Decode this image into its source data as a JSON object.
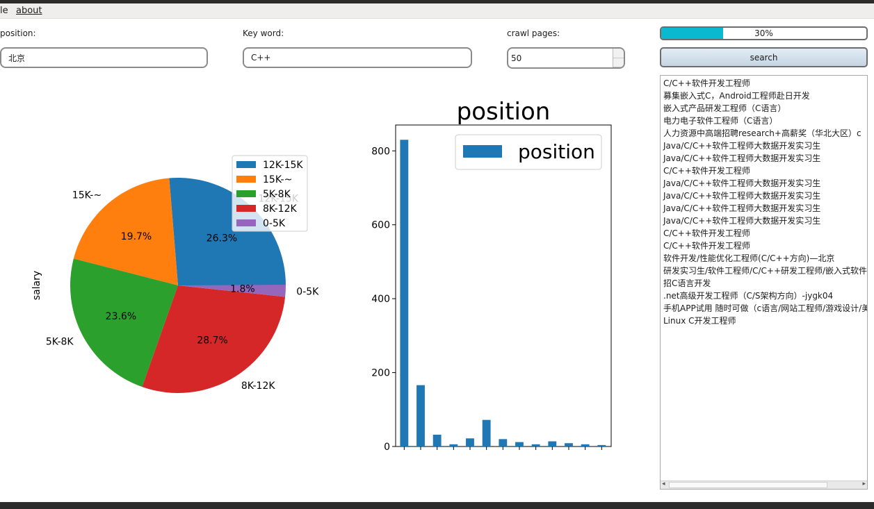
{
  "menu": {
    "file": "le",
    "about": "about"
  },
  "form": {
    "position_label": "position:",
    "position_value": "北京",
    "keyword_label": "Key word:",
    "keyword_value": "C++",
    "pages_label": "crawl pages:",
    "pages_value": "50"
  },
  "progress": {
    "text": "30%",
    "value": 0.3
  },
  "search_button": "search",
  "results": [
    "C/C++软件开发工程师",
    "募集嵌入式C，Android工程师赴日开发",
    "嵌入式产品研发工程师（C语言）",
    "电力电子软件工程师（C语言）",
    "人力资源中高端招聘research+高薪奖（华北大区）c",
    "Java/C/C++软件工程师大数据开发实习生",
    "Java/C/C++软件工程师大数据开发实习生",
    "C/C++软件开发工程师",
    "Java/C/C++软件工程师大数据开发实习生",
    "Java/C/C++软件工程师大数据开发实习生",
    "Java/C/C++软件工程师大数据开发实习生",
    "Java/C/C++软件工程师大数据开发实习生",
    "C/C++软件开发工程师",
    "C/C++软件开发工程师",
    "软件开发/性能优化工程师(C/C++方向)—北京",
    "研发实习生/软件工程师/C/C++研发工程师/嵌入式软件开",
    "招C语言开发",
    ".net高级开发工程师（C/S架构方向）-jygk04",
    "手机APP试用 随时可做（c语言/网站工程师/游戏设计/美",
    "Linux C开发工程师"
  ],
  "chart_data": [
    {
      "type": "pie",
      "ylabel": "salary",
      "slices": [
        {
          "label": "12K-15K",
          "percent": 26.3,
          "pct_label": "26.3%",
          "color": "#1f77b4"
        },
        {
          "label": "15K-~",
          "percent": 19.7,
          "pct_label": "19.7%",
          "color": "#ff7f0e"
        },
        {
          "label": "5K-8K",
          "percent": 23.6,
          "pct_label": "23.6%",
          "color": "#2ca02c"
        },
        {
          "label": "8K-12K",
          "percent": 28.7,
          "pct_label": "28.7%",
          "color": "#d62728"
        },
        {
          "label": "0-5K",
          "percent": 1.8,
          "pct_label": "1.8%",
          "color": "#9467bd"
        }
      ],
      "legend": [
        "12K-15K",
        "15K-~",
        "5K-8K",
        "8K-12K",
        "0-5K"
      ],
      "legend_position": "upper-right"
    },
    {
      "type": "bar",
      "title": "position",
      "series_name": "position",
      "color": "#1f77b4",
      "values": [
        830,
        166,
        32,
        6,
        22,
        72,
        20,
        12,
        6,
        14,
        9,
        6,
        4
      ],
      "ylim": [
        0,
        870
      ],
      "yticks": [
        0,
        200,
        400,
        600,
        800
      ],
      "legend_position": "upper-right"
    }
  ]
}
